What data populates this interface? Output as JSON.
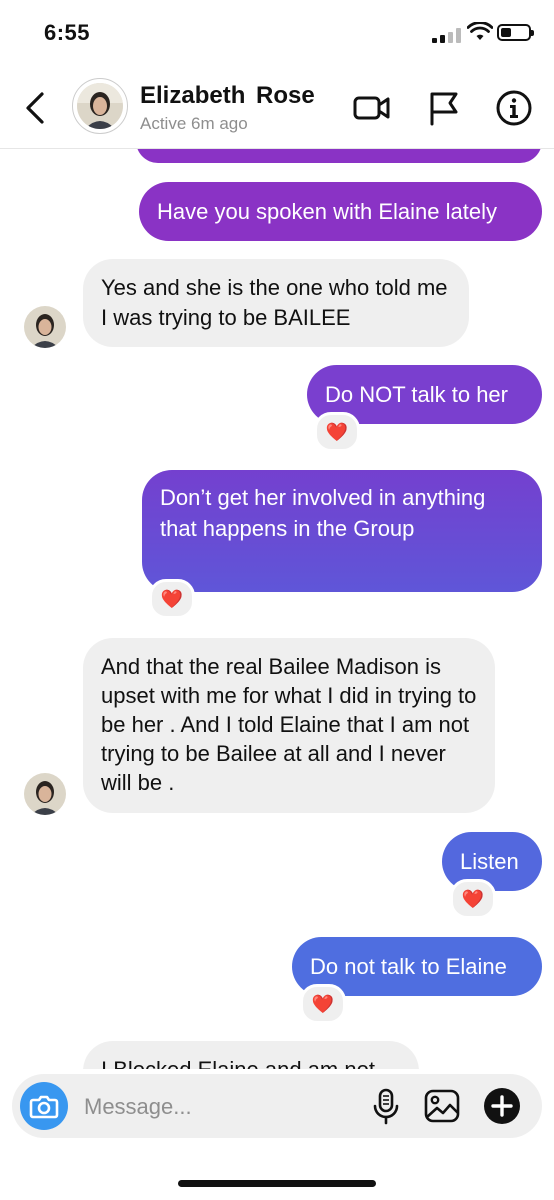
{
  "status_bar": {
    "time": "6:55"
  },
  "header": {
    "name": "Elizabeth  Rose",
    "status": "Active 6m ago",
    "icons": [
      "back-icon",
      "video-call-icon",
      "flag-icon",
      "info-icon"
    ]
  },
  "messages": [
    {
      "sender": "me",
      "text": "Have you spoken with Elaine lately"
    },
    {
      "sender": "them",
      "text": "Yes and she is the one who told me I was trying to be BAILEE"
    },
    {
      "sender": "me",
      "text": "Do NOT talk to her",
      "reaction": "❤️"
    },
    {
      "sender": "me",
      "text": "Don’t get her involved in anything that happens in the Group",
      "reaction": "❤️"
    },
    {
      "sender": "them",
      "text": "And that the real Bailee Madison is upset with me for what I did in trying to be her .  And I told Elaine that I am not trying to be Bailee at all and I never will be ."
    },
    {
      "sender": "me",
      "text": "Listen",
      "reaction": "❤️"
    },
    {
      "sender": "me",
      "text": "Do not talk to Elaine",
      "reaction": "❤️"
    },
    {
      "sender": "them",
      "text": "I Blocked Elaine and am not"
    }
  ],
  "composer": {
    "placeholder": "Message...",
    "icons": [
      "camera-icon",
      "microphone-icon",
      "gallery-icon",
      "add-icon"
    ]
  },
  "colors": {
    "bubble_purple": "#8a33c5",
    "bubble_violet": "#6e48d4",
    "bubble_blue": "#4f6ee0",
    "bubble_incoming": "#efefef",
    "camera_blue": "#3897f0"
  }
}
